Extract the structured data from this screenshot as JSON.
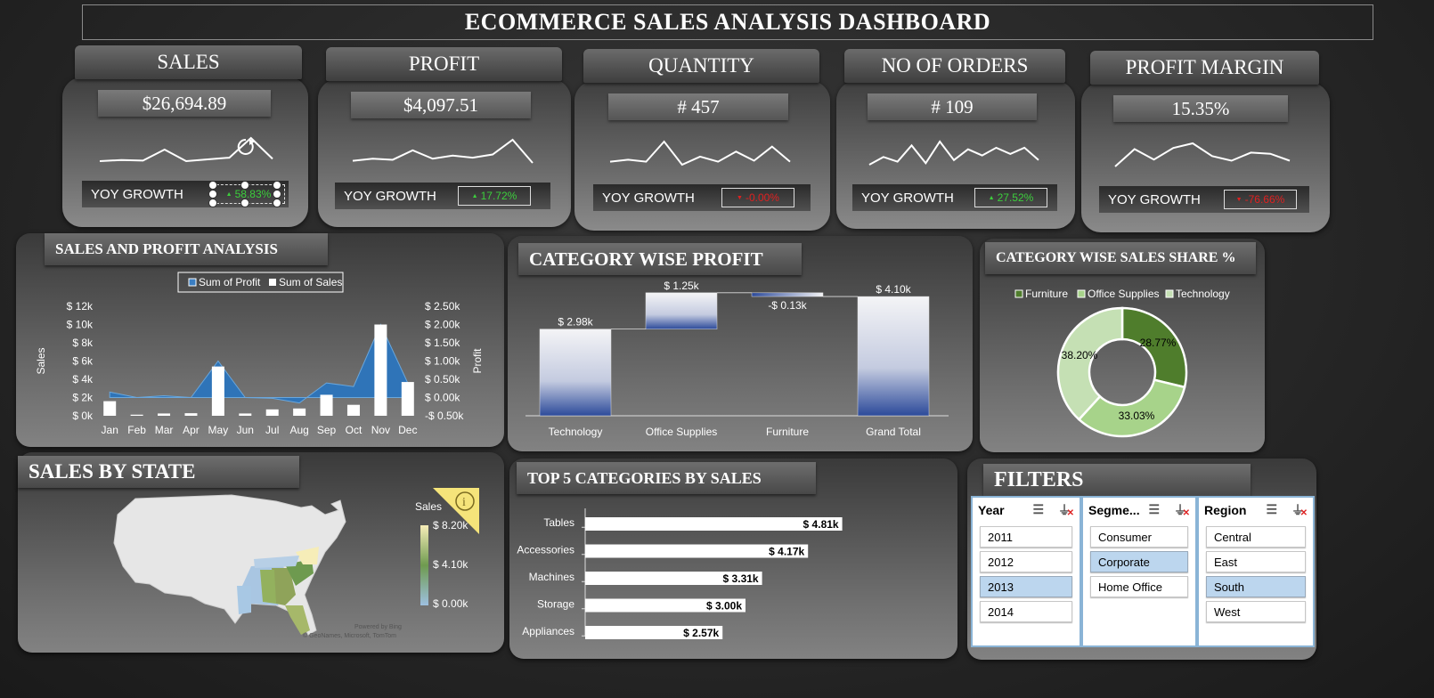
{
  "title": "ECOMMERCE SALES ANALYSIS DASHBOARD",
  "kpis": [
    {
      "label": "SALES",
      "value": "$26,694.89",
      "yoy_label": "YOY GROWTH",
      "yoy": "58.83%",
      "trend": "up",
      "color": "#3ccf3c",
      "spark": [
        3,
        3.2,
        3.1,
        5,
        3,
        3.3,
        3.6,
        7,
        3.4
      ]
    },
    {
      "label": "PROFIT",
      "value": "$4,097.51",
      "yoy_label": "YOY GROWTH",
      "yoy": "17.72%",
      "trend": "up",
      "color": "#3ccf3c",
      "spark": [
        4,
        4.2,
        4.1,
        5,
        4.2,
        4.5,
        4.3,
        4.6,
        6,
        3.8
      ]
    },
    {
      "label": "QUANTITY",
      "value": "# 457",
      "yoy_label": "YOY GROWTH",
      "yoy": "-0.00%",
      "trend": "down",
      "color": "#e02020",
      "spark": [
        3,
        3.4,
        3,
        7,
        2.4,
        4,
        3,
        5,
        3.2,
        6,
        3
      ]
    },
    {
      "label": "NO OF ORDERS",
      "value": "# 109",
      "yoy_label": "YOY GROWTH",
      "yoy": "27.52%",
      "trend": "up",
      "color": "#3ccf3c",
      "spark": [
        3,
        4,
        3.4,
        5.5,
        3.2,
        6,
        3.6,
        5,
        4.2,
        5.2,
        4.4,
        5.2,
        3.6
      ]
    },
    {
      "label": "PROFIT MARGIN",
      "value": "15.35%",
      "yoy_label": "YOY GROWTH",
      "yoy": "-76.66%",
      "trend": "down",
      "color": "#e02020",
      "spark": [
        4,
        5.5,
        4.6,
        5.6,
        6,
        4.9,
        4.5,
        5.2,
        5.1,
        4.5
      ]
    }
  ],
  "sales_profit": {
    "tab": "SALES AND PROFIT ANALYSIS",
    "chart_data": {
      "type": "bar",
      "categories": [
        "Jan",
        "Feb",
        "Mar",
        "Apr",
        "May",
        "Jun",
        "Jul",
        "Aug",
        "Sep",
        "Oct",
        "Nov",
        "Dec"
      ],
      "series": [
        {
          "name": "Sum of Profit",
          "type": "area",
          "axis": "right",
          "values": [
            0.15,
            0.0,
            0.05,
            0.0,
            1.0,
            0.0,
            -0.02,
            -0.15,
            0.4,
            0.3,
            2.0,
            0.4
          ]
        },
        {
          "name": "Sum of Sales",
          "type": "bar",
          "axis": "left",
          "values": [
            1600,
            120,
            250,
            280,
            5400,
            250,
            700,
            800,
            2300,
            1200,
            10000,
            3700
          ]
        }
      ],
      "ylabel": "Sales",
      "y2label": "Profit",
      "yticks": [
        "$ 0k",
        "$ 2k",
        "$ 4k",
        "$ 6k",
        "$ 8k",
        "$ 10k",
        "$ 12k"
      ],
      "y2ticks": [
        "-$ 0.50k",
        "$ 0.00k",
        "$ 0.50k",
        "$ 1.00k",
        "$ 1.50k",
        "$ 2.00k",
        "$ 2.50k"
      ],
      "ylim": [
        0,
        12000
      ],
      "y2lim": [
        -0.5,
        2.5
      ]
    }
  },
  "category_profit": {
    "tab": "CATEGORY WISE PROFIT",
    "chart_data": {
      "type": "bar",
      "categories": [
        "Technology",
        "Office Supplies",
        "Furniture",
        "Grand Total"
      ],
      "values": [
        2.98,
        1.25,
        -0.13,
        4.1
      ],
      "labels": [
        "$ 2.98k",
        "$ 1.25k",
        "-$ 0.13k",
        "$ 4.10k"
      ],
      "ylim": [
        0,
        4.5
      ]
    }
  },
  "sales_share": {
    "tab": "CATEGORY WISE SALES SHARE %",
    "chart_data": {
      "type": "pie",
      "categories": [
        "Furniture",
        "Office Supplies",
        "Technology"
      ],
      "values": [
        28.77,
        33.03,
        38.2
      ],
      "labels": [
        "28.77%",
        "33.03%",
        "38.20%"
      ],
      "colors": [
        "#4f7d2c",
        "#a7d38a",
        "#c5e0b4"
      ]
    }
  },
  "state": {
    "tab": "SALES BY STATE",
    "legend_title": "Sales",
    "legend_ticks": [
      "$ 8.20k",
      "$ 4.10k",
      "$ 0.00k"
    ],
    "credit1": "Powered by Bing",
    "credit2": "© GeoNames, Microsoft, TomTom",
    "info_icon": "info-icon"
  },
  "top5": {
    "tab": "TOP 5  CATEGORIES BY SALES",
    "chart_data": {
      "type": "bar",
      "categories": [
        "Tables",
        "Accessories",
        "Machines",
        "Storage",
        "Appliances"
      ],
      "values": [
        4.81,
        4.17,
        3.31,
        3.0,
        2.57
      ],
      "labels": [
        "$ 4.81k",
        "$ 4.17k",
        "$ 3.31k",
        "$ 3.00k",
        "$ 2.57k"
      ]
    }
  },
  "filters": {
    "tab": "FILTERS",
    "slicers": [
      {
        "title": "Year",
        "items": [
          {
            "label": "2011",
            "sel": false
          },
          {
            "label": "2012",
            "sel": false
          },
          {
            "label": "2013",
            "sel": true
          },
          {
            "label": "2014",
            "sel": false
          }
        ]
      },
      {
        "title": "Segme...",
        "items": [
          {
            "label": "Consumer",
            "sel": false
          },
          {
            "label": "Corporate",
            "sel": true
          },
          {
            "label": "Home Office",
            "sel": false
          }
        ]
      },
      {
        "title": "Region",
        "items": [
          {
            "label": "Central",
            "sel": false
          },
          {
            "label": "East",
            "sel": false
          },
          {
            "label": "South",
            "sel": true
          },
          {
            "label": "West",
            "sel": false
          }
        ]
      }
    ]
  }
}
